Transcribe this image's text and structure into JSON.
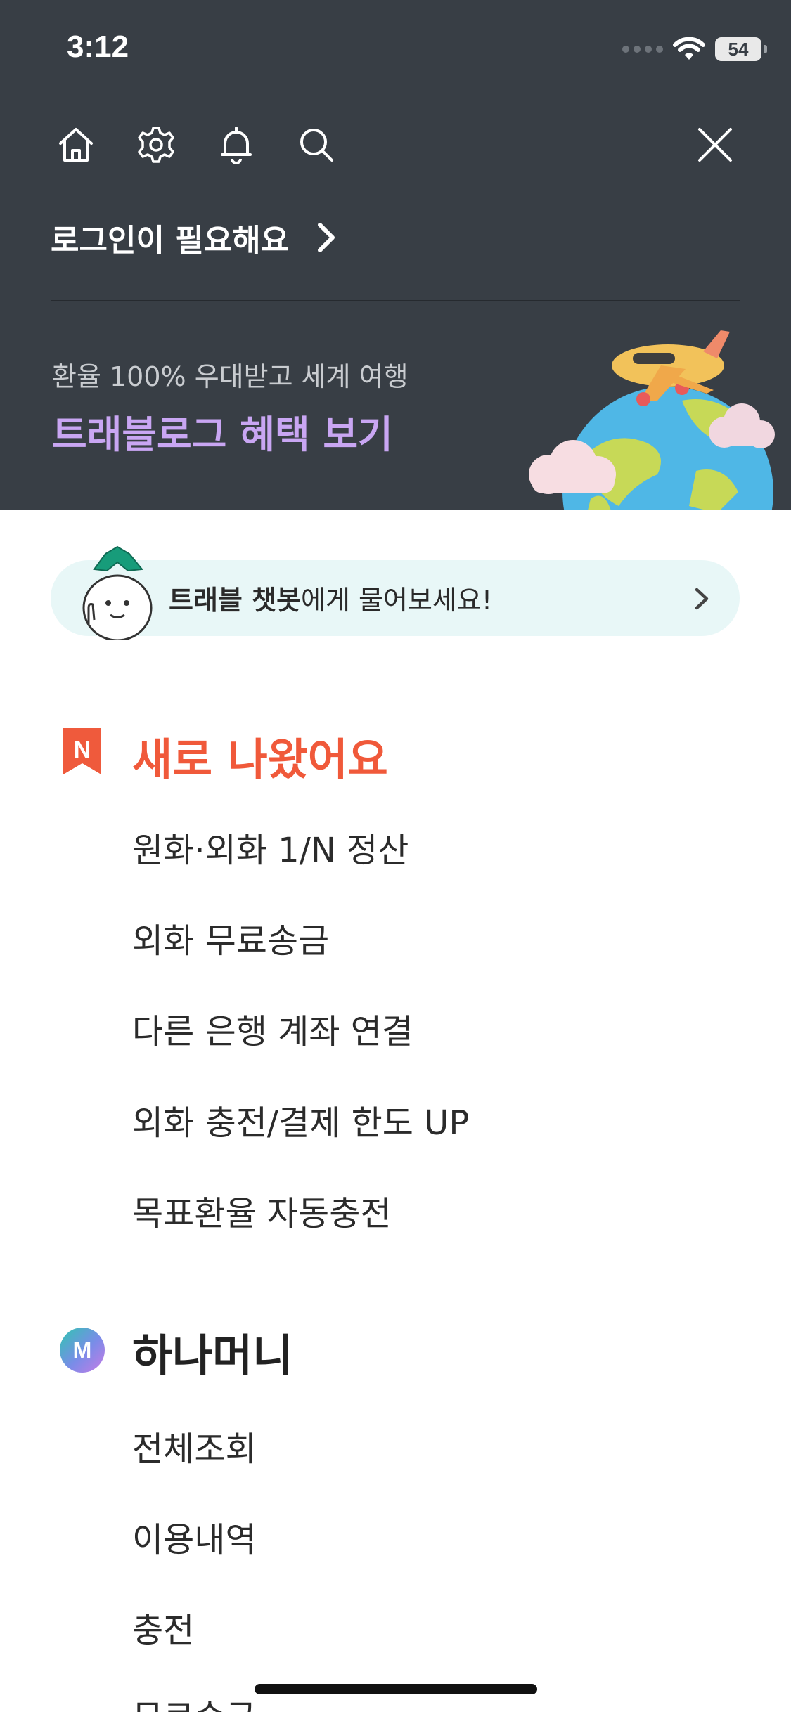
{
  "status": {
    "time": "3:12",
    "battery": "54"
  },
  "toolbar": {
    "icons": [
      "home-icon",
      "gear-icon",
      "bell-icon",
      "search-icon",
      "close-icon"
    ]
  },
  "login": {
    "label": "로그인이 필요해요"
  },
  "promo": {
    "subtitle": "환율 100% 우대받고 세계 여행",
    "title": "트래블로그 혜택 보기",
    "title_color": "#c9a6f3"
  },
  "chatbot": {
    "bold": "트래블 챗봇",
    "rest": "에게 물어보세요!"
  },
  "new_section": {
    "badge": "N",
    "title": "새로 나왔어요",
    "title_color": "#f0593a",
    "items": [
      {
        "label": "원화·외화 1/N 정산"
      },
      {
        "label": "외화 무료송금"
      },
      {
        "label": "다른 은행 계좌 연결"
      },
      {
        "label": "외화 충전/결제 한도 UP"
      },
      {
        "label": "목표환율 자동충전"
      }
    ]
  },
  "money_section": {
    "badge": "M",
    "title": "하나머니",
    "items": [
      {
        "label": "전체조회"
      },
      {
        "label": "이용내역"
      },
      {
        "label": "충전"
      },
      {
        "label": "무료송금"
      }
    ]
  },
  "colors": {
    "header_bg": "#383e45",
    "chatbot_bg": "#e8f7f7"
  }
}
